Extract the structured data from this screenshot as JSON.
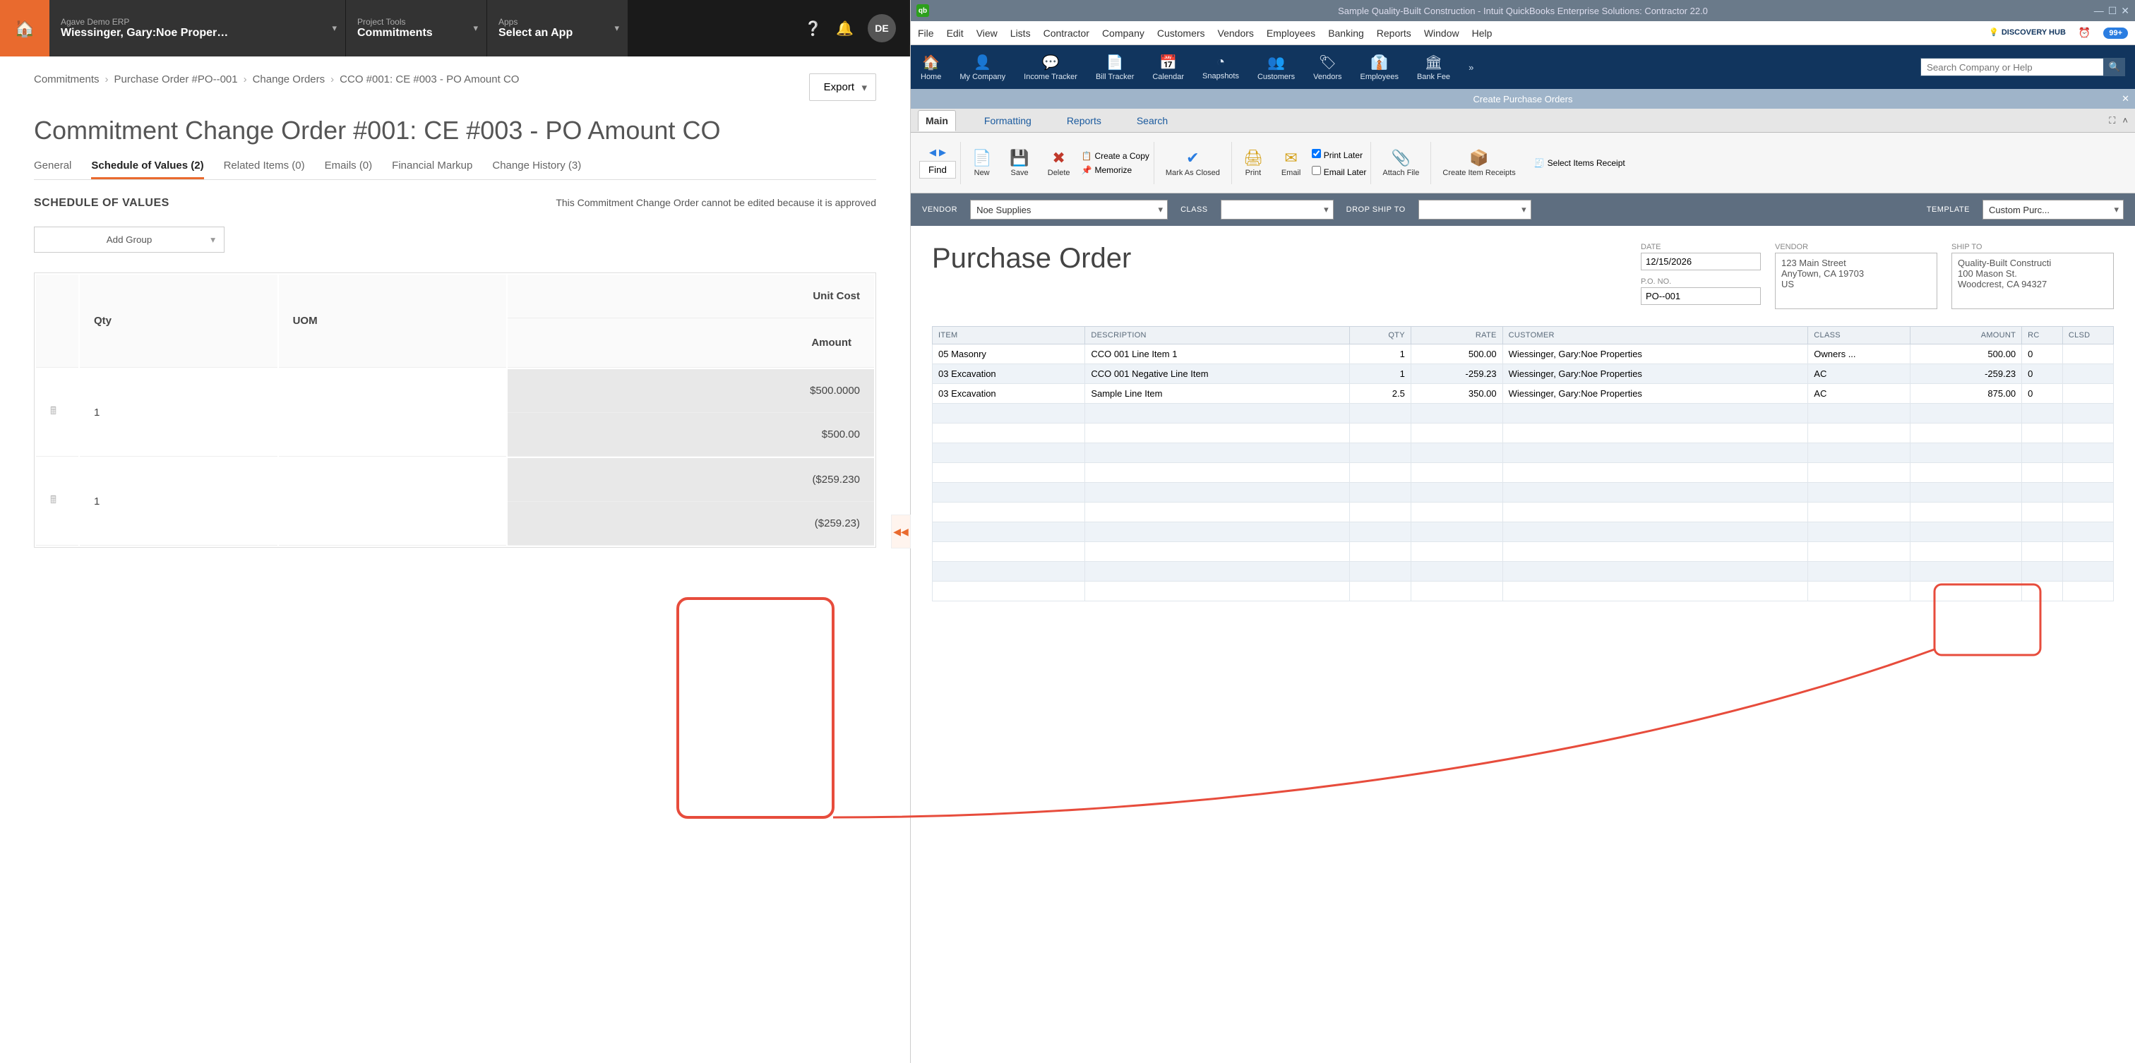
{
  "left": {
    "top": {
      "erp_label": "Agave Demo ERP",
      "erp_value": "Wiessinger, Gary:Noe Proper…",
      "tools_label": "Project Tools",
      "tools_value": "Commitments",
      "apps_label": "Apps",
      "apps_value": "Select an App",
      "avatar": "DE"
    },
    "crumbs": {
      "c1": "Commitments",
      "c2": "Purchase Order #PO--001",
      "c3": "Change Orders",
      "c4": "CCO #001: CE #003 - PO Amount CO"
    },
    "export": "Export",
    "title": "Commitment Change Order #001: CE #003 - PO Amount CO",
    "tabs": {
      "general": "General",
      "sov": "Schedule of Values (2)",
      "related": "Related Items (0)",
      "emails": "Emails (0)",
      "markup": "Financial Markup",
      "history": "Change History (3)"
    },
    "sov_heading": "SCHEDULE OF VALUES",
    "sov_note": "This Commitment Change Order cannot be edited because it is approved",
    "add_group": "Add Group",
    "grid": {
      "h_qty": "Qty",
      "h_uom": "UOM",
      "h_unit": "Unit Cost",
      "h_amt": "Amount",
      "r1_qty": "1",
      "r1_unit": "$500.0000",
      "r1_amt": "$500.00",
      "r2_qty": "1",
      "r2_unit": "($259.230",
      "r2_amt": "($259.23)"
    }
  },
  "right": {
    "titlebar": "Sample Quality-Built Construction  -  Intuit QuickBooks Enterprise Solutions: Contractor 22.0",
    "menus": [
      "File",
      "Edit",
      "View",
      "Lists",
      "Contractor",
      "Company",
      "Customers",
      "Vendors",
      "Employees",
      "Banking",
      "Reports",
      "Window",
      "Help"
    ],
    "discovery": "DISCOVERY HUB",
    "badge": "99+",
    "tb": [
      "Home",
      "My Company",
      "Income Tracker",
      "Bill Tracker",
      "Calendar",
      "Snapshots",
      "Customers",
      "Vendors",
      "Employees",
      "Bank Fee"
    ],
    "search_ph": "Search Company or Help",
    "doc_title": "Create Purchase Orders",
    "tabs": {
      "main": "Main",
      "fmt": "Formatting",
      "rep": "Reports",
      "srch": "Search"
    },
    "ribbon": {
      "find": "Find",
      "new": "New",
      "save": "Save",
      "delete": "Delete",
      "copy": "Create a Copy",
      "memo": "Memorize",
      "mark": "Mark As Closed",
      "print": "Print",
      "email": "Email",
      "plater": "Print Later",
      "elater": "Email Later",
      "attach": "Attach File",
      "citem": "Create Item Receipts",
      "sitems": "Select Items Receipt"
    },
    "formbar": {
      "vendor_l": "VENDOR",
      "vendor_v": "Noe Supplies",
      "class_l": "CLASS",
      "class_v": "",
      "drop_l": "DROP SHIP TO",
      "drop_v": "",
      "tmpl_l": "TEMPLATE",
      "tmpl_v": "Custom Purc..."
    },
    "po": {
      "heading": "Purchase Order",
      "date_l": "DATE",
      "date_v": "12/15/2026",
      "pono_l": "P.O. NO.",
      "pono_v": "PO--001",
      "vend_l": "VENDOR",
      "vend_addr": "123 Main Street\nAnyTown, CA 19703\nUS",
      "ship_l": "SHIP TO",
      "ship_addr": "Quality-Built Constructi\n100 Mason St.\nWoodcrest, CA 94327"
    },
    "grid": {
      "h": {
        "item": "ITEM",
        "desc": "DESCRIPTION",
        "qty": "QTY",
        "rate": "RATE",
        "cust": "CUSTOMER",
        "class": "CLASS",
        "amt": "AMOUNT",
        "rc": "RC",
        "clsd": "CLSD"
      },
      "rows": [
        {
          "item": "05 Masonry",
          "desc": "CCO 001 Line Item 1",
          "qty": "1",
          "rate": "500.00",
          "cust": "Wiessinger, Gary:Noe Properties",
          "class": "Owners ...",
          "amt": "500.00",
          "rc": "0"
        },
        {
          "item": "03 Excavation",
          "desc": "CCO 001 Negative Line Item",
          "qty": "1",
          "rate": "-259.23",
          "cust": "Wiessinger, Gary:Noe Properties",
          "class": "AC",
          "amt": "-259.23",
          "rc": "0"
        },
        {
          "item": "03 Excavation",
          "desc": "Sample Line Item",
          "qty": "2.5",
          "rate": "350.00",
          "cust": "Wiessinger, Gary:Noe Properties",
          "class": "AC",
          "amt": "875.00",
          "rc": "0"
        }
      ]
    }
  }
}
